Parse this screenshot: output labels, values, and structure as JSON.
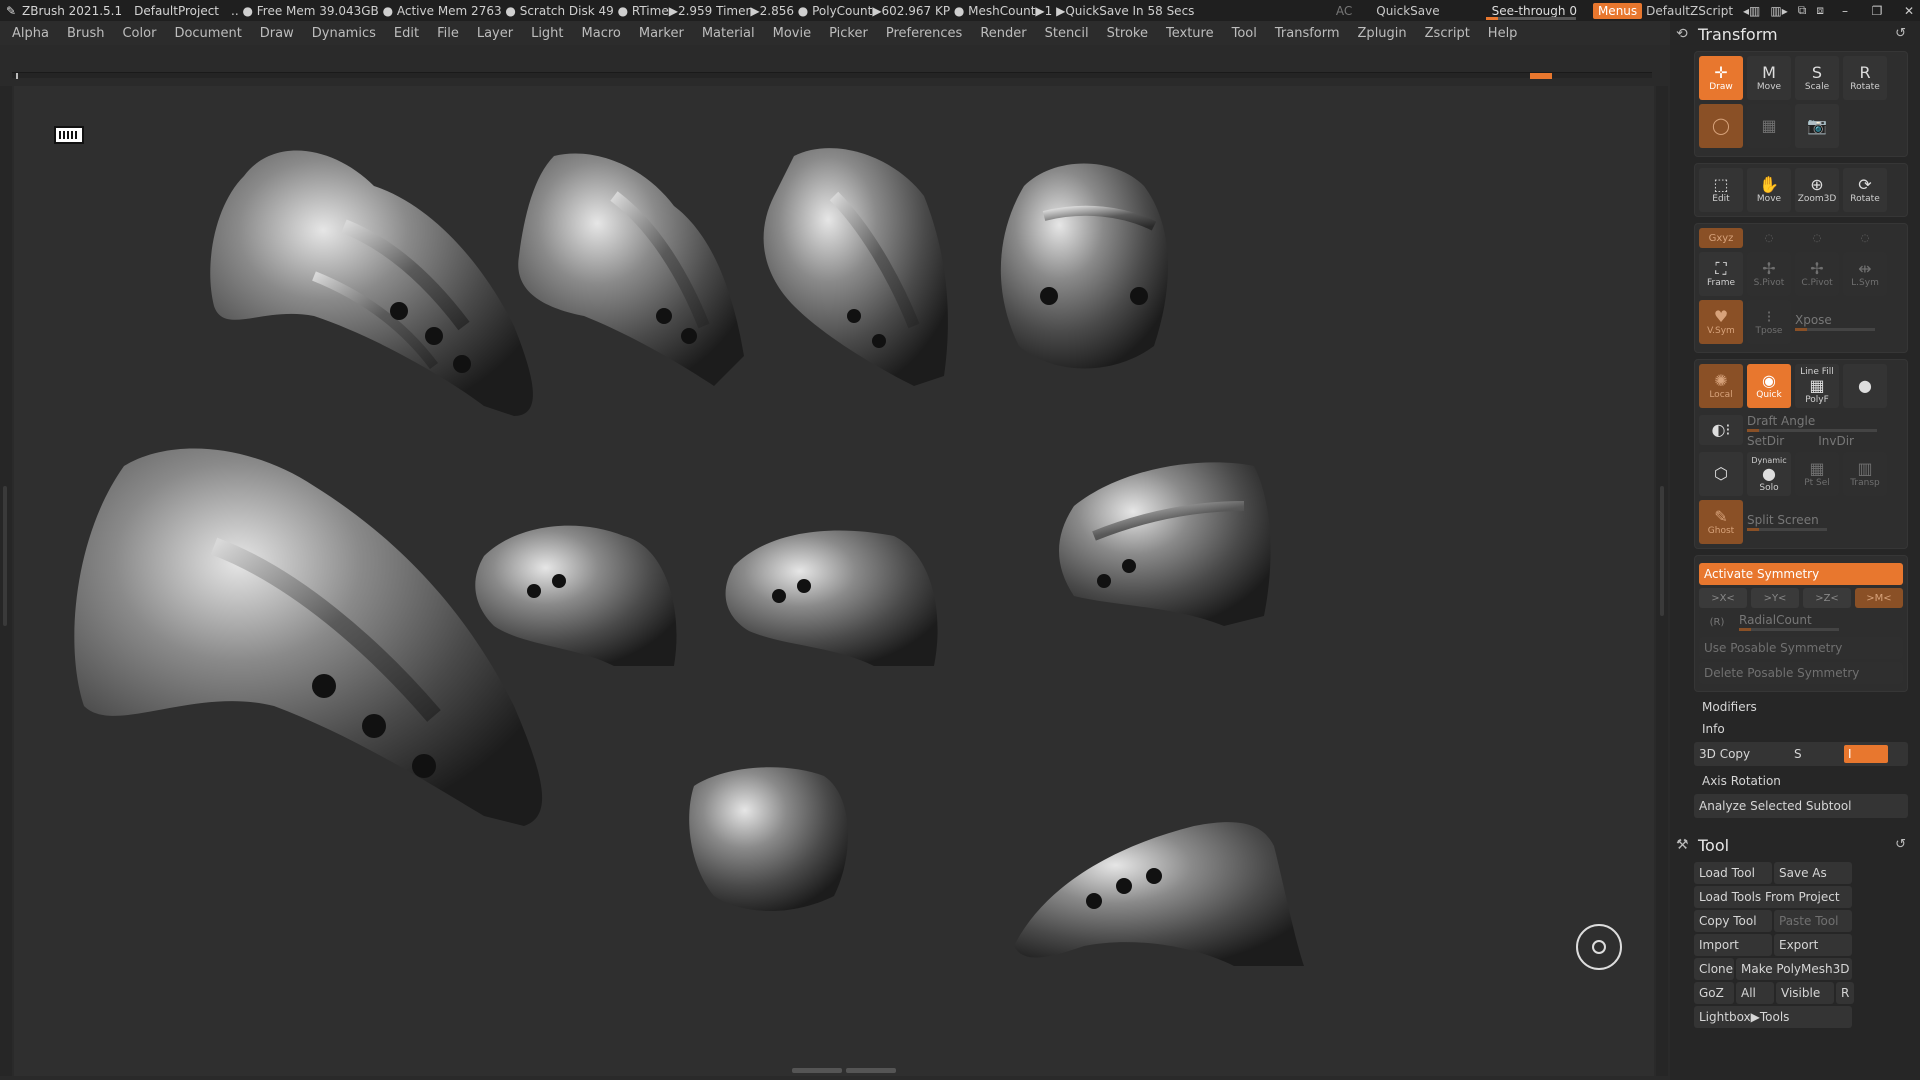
{
  "titlebar": {
    "app": "ZBrush 2021.5.1",
    "project": "DefaultProject",
    "status": ".. ● Free Mem 39.043GB ● Active Mem 2763 ● Scratch Disk 49 ● RTime▶2.959 Timer▶2.856 ● PolyCount▶602.967 KP ● MeshCount▶1 ▶QuickSave In 58 Secs",
    "ac": "AC",
    "quicksave": "QuickSave",
    "seethrough": "See-through 0",
    "menus": "Menus",
    "script": "DefaultZScript"
  },
  "menubar": [
    "Alpha",
    "Brush",
    "Color",
    "Document",
    "Draw",
    "Dynamics",
    "Edit",
    "File",
    "Layer",
    "Light",
    "Macro",
    "Marker",
    "Material",
    "Movie",
    "Picker",
    "Preferences",
    "Render",
    "Stencil",
    "Stroke",
    "Texture",
    "Tool",
    "Transform",
    "Zplugin",
    "Zscript",
    "Help"
  ],
  "transform": {
    "title": "Transform",
    "row1": [
      {
        "label": "Draw",
        "glyph": "✛"
      },
      {
        "label": "Move",
        "glyph": "M"
      },
      {
        "label": "Scale",
        "glyph": "S"
      },
      {
        "label": "Rotate",
        "glyph": "R"
      }
    ],
    "row3": [
      {
        "label": "Edit",
        "glyph": "⬚"
      },
      {
        "label": "Move",
        "glyph": "✋"
      },
      {
        "label": "Zoom3D",
        "glyph": "⊕"
      },
      {
        "label": "Rotate",
        "glyph": "⟳"
      }
    ],
    "row4": [
      {
        "label": "Frame",
        "glyph": "⛶"
      },
      {
        "label": "S.Pivot",
        "glyph": "✢"
      },
      {
        "label": "C.Pivot",
        "glyph": "✢"
      },
      {
        "label": "L.Sym",
        "glyph": "⇹"
      }
    ],
    "xyz": "Gxyz",
    "xpose": "Xpose",
    "vsym": "V.Sym",
    "tpose": "Tpose",
    "local": "Local",
    "quick": "Quick",
    "polyf": "PolyF",
    "linefill": "Line Fill",
    "draft_angle": "Draft Angle",
    "setdir": "SetDir",
    "invdir": "InvDir",
    "dynamic": "Dynamic",
    "solo": "Solo",
    "ptsel": "Pt Sel",
    "transp": "Transp",
    "ghost": "Ghost",
    "split_screen": "Split Screen",
    "activate_symmetry": "Activate Symmetry",
    "sym_axes": [
      ">X<",
      ">Y<",
      ">Z<",
      ">M<"
    ],
    "r_label": "(R)",
    "radial_count": "RadialCount",
    "use_posable": "Use Posable Symmetry",
    "delete_posable": "Delete Posable Symmetry",
    "modifiers": "Modifiers",
    "info": "Info",
    "copy3d": "3D Copy",
    "copy_s": "S",
    "copy_i": "I",
    "axis_rotation": "Axis Rotation",
    "analyze": "Analyze Selected Subtool"
  },
  "tool": {
    "title": "Tool",
    "rows": [
      [
        {
          "label": "Load Tool",
          "dim": false,
          "w": 78
        },
        {
          "label": "Save As",
          "dim": false,
          "w": 78
        }
      ],
      [
        {
          "label": "Load Tools From Project",
          "dim": false,
          "w": 158
        }
      ],
      [
        {
          "label": "Copy Tool",
          "dim": false,
          "w": 78
        },
        {
          "label": "Paste Tool",
          "dim": true,
          "w": 78
        }
      ],
      [
        {
          "label": "Import",
          "dim": false,
          "w": 78
        },
        {
          "label": "Export",
          "dim": false,
          "w": 78
        }
      ],
      [
        {
          "label": "Clone",
          "dim": false,
          "w": 40
        },
        {
          "label": "Make PolyMesh3D",
          "dim": false,
          "w": 116
        }
      ],
      [
        {
          "label": "GoZ",
          "dim": false,
          "w": 40
        },
        {
          "label": "All",
          "dim": false,
          "w": 38
        },
        {
          "label": "Visible",
          "dim": false,
          "w": 58
        },
        {
          "label": "R",
          "dim": false,
          "w": 18
        }
      ],
      [
        {
          "label": "Lightbox▶Tools",
          "dim": false,
          "w": 158
        }
      ]
    ]
  },
  "colors": {
    "accent": "#e8772e",
    "panel": "#262626",
    "canvas": "#2f2f2f"
  }
}
